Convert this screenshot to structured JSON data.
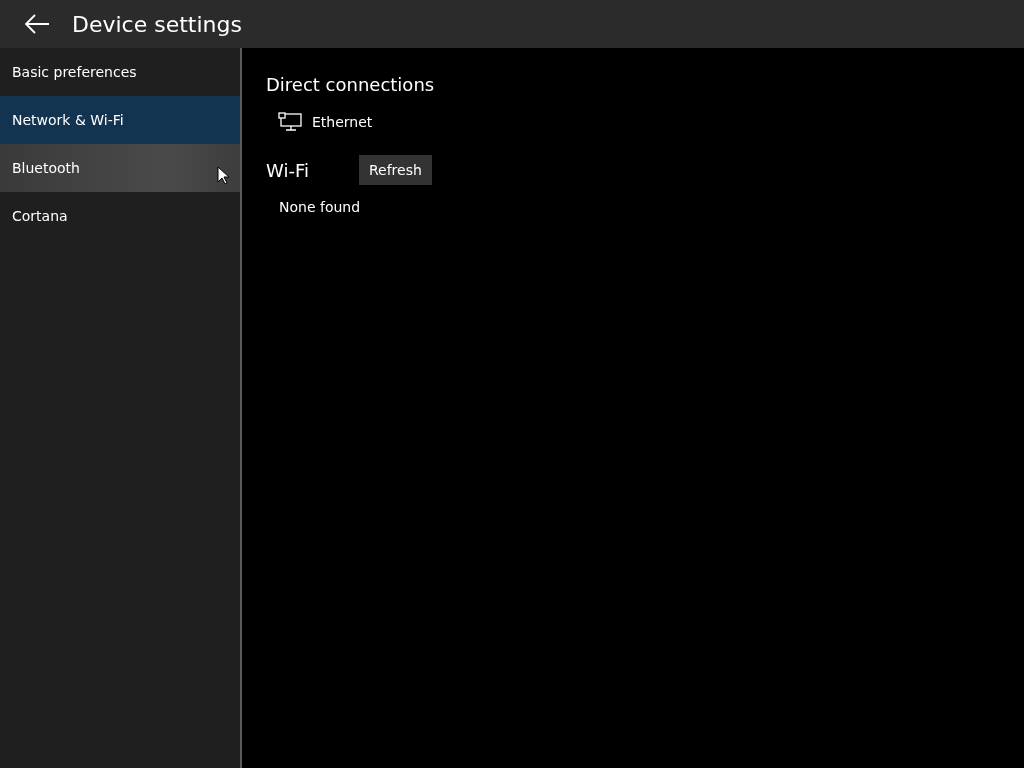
{
  "header": {
    "title": "Device settings"
  },
  "sidebar": {
    "items": [
      {
        "label": "Basic preferences",
        "selected": false,
        "hovered": false
      },
      {
        "label": "Network & Wi-Fi",
        "selected": true,
        "hovered": false
      },
      {
        "label": "Bluetooth",
        "selected": false,
        "hovered": true
      },
      {
        "label": "Cortana",
        "selected": false,
        "hovered": false
      }
    ]
  },
  "direct_connections": {
    "heading": "Direct connections",
    "items": [
      {
        "label": "Ethernet"
      }
    ]
  },
  "wifi": {
    "heading": "Wi-Fi",
    "refresh_button": "Refresh",
    "status": "None found"
  }
}
